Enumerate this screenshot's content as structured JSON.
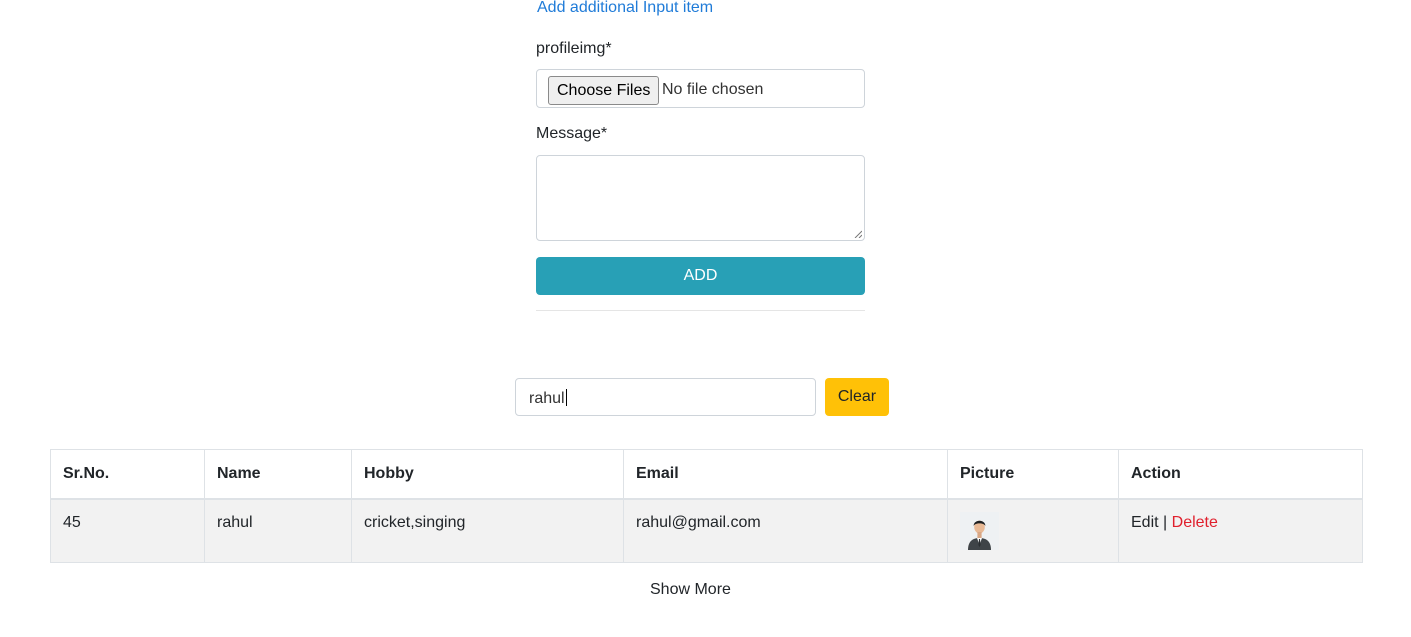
{
  "form": {
    "add_link": "Add additional Input item",
    "profile_label": "profileimg*",
    "file_button": "Choose Files",
    "file_status": "No file chosen",
    "message_label": "Message*",
    "message_value": "",
    "submit_label": "ADD"
  },
  "search": {
    "value": "rahul",
    "clear_label": "Clear"
  },
  "table": {
    "headers": [
      "Sr.No.",
      "Name",
      "Hobby",
      "Email",
      "Picture",
      "Action"
    ],
    "rows": [
      {
        "sr_no": "45",
        "name": "rahul",
        "hobby": "cricket,singing",
        "email": "rahul@gmail.com",
        "picture_icon": "user-avatar-icon",
        "edit_label": "Edit",
        "separator": "|",
        "delete_label": "Delete"
      }
    ]
  },
  "show_more_label": "Show More",
  "colors": {
    "link": "#1f7bd8",
    "add_button": "#28a0b6",
    "clear_button": "#ffc107",
    "delete_link": "#e0202d",
    "row_background": "#f2f2f2"
  }
}
